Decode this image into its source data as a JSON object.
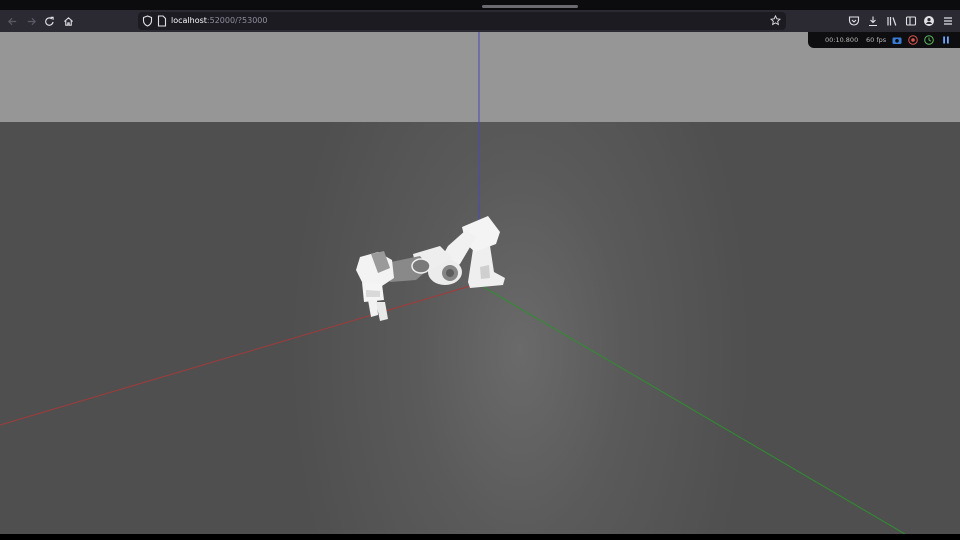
{
  "browser": {
    "url_host": "localhost",
    "url_path": ":52000/?53000",
    "icons": {
      "back": "back-arrow-icon",
      "forward": "forward-arrow-icon",
      "reload": "reload-icon",
      "home": "home-icon",
      "shield": "shield-icon",
      "page": "page-icon",
      "bookmark": "star-icon",
      "pocket": "pocket-icon",
      "downloads": "download-icon",
      "library": "library-icon",
      "sidebar": "sidebar-icon",
      "account": "account-icon",
      "menu": "hamburger-menu-icon"
    }
  },
  "viewer": {
    "sim_time": "00:10.800",
    "fps": "60 fps",
    "icons": [
      "camera-icon",
      "record-icon",
      "realtime-icon",
      "pause-icon"
    ],
    "colors": {
      "sky": "#969696",
      "ground": "#525252",
      "axis_x": "#a33a3a",
      "axis_y": "#2f8f2f",
      "axis_z": "#4a4ab0",
      "robot_body": "#f2f2f2",
      "robot_joint": "#7f7f7f"
    }
  }
}
